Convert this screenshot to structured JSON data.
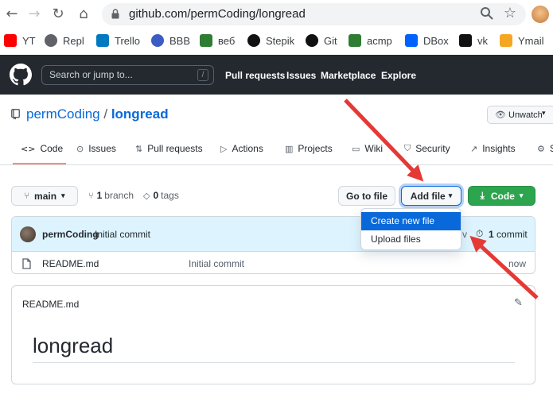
{
  "browser": {
    "url": "github.com/permCoding/longread",
    "bookmarks": [
      {
        "label": "YT",
        "color": "#ff0000"
      },
      {
        "label": "Repl",
        "color": "#5f6368"
      },
      {
        "label": "Trello",
        "color": "#0079bf"
      },
      {
        "label": "BBB",
        "color": "#3b5cc4"
      },
      {
        "label": "веб",
        "color": "#2e7d32"
      },
      {
        "label": "Stepik",
        "color": "#111111"
      },
      {
        "label": "Git",
        "color": "#111111"
      },
      {
        "label": "acmp",
        "color": "#2e7d32"
      },
      {
        "label": "DBox",
        "color": "#0061fe"
      },
      {
        "label": "vk",
        "color": "#111111"
      },
      {
        "label": "Ymail",
        "color": "#f5a623"
      }
    ]
  },
  "header": {
    "search_placeholder": "Search or jump to...",
    "search_shortcut": "/",
    "nav": [
      "Pull requests",
      "Issues",
      "Marketplace",
      "Explore"
    ]
  },
  "repo": {
    "owner": "permCoding",
    "separator": "/",
    "name": "longread",
    "unwatch_label": "Unwatch"
  },
  "tabs": [
    "Code",
    "Issues",
    "Pull requests",
    "Actions",
    "Projects",
    "Wiki",
    "Security",
    "Insights",
    "S"
  ],
  "toolbar": {
    "branch": "main",
    "branch_count": "1",
    "branch_word": "branch",
    "tag_count": "0",
    "tag_word": "tags",
    "goto_file": "Go to file",
    "add_file": "Add file",
    "code": "Code"
  },
  "dropdown": {
    "items": [
      "Create new file",
      "Upload files"
    ]
  },
  "commit": {
    "author": "permCoding",
    "message": "Initial commit",
    "count": "1",
    "count_word": "commit",
    "hash_partial": "v"
  },
  "files": [
    {
      "name": "README.md",
      "message": "Initial commit",
      "age": "now"
    }
  ],
  "readme": {
    "filename": "README.md",
    "heading": "longread"
  },
  "colors": {
    "accent": "#0969da",
    "primary_button": "#2da44e",
    "arrow": "#e53935"
  }
}
